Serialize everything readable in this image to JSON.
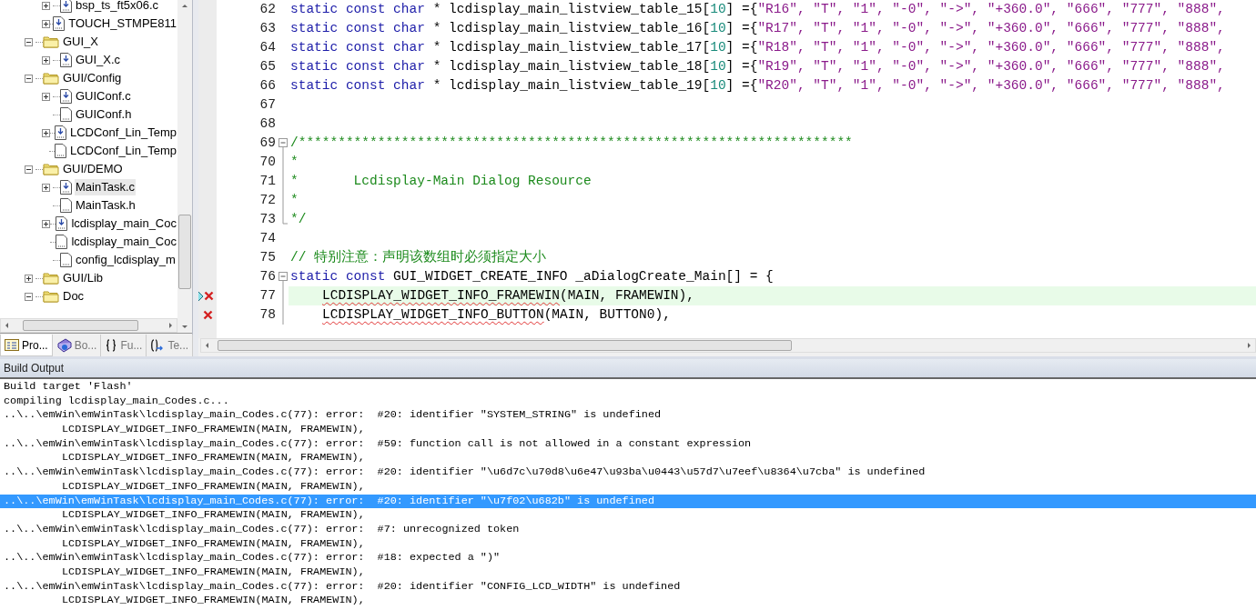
{
  "project_panel": {
    "tree": {
      "continued_items": [
        {
          "label": "bsp_ts_ft5x06.c",
          "kind": "source",
          "expanded": false,
          "selected": false
        },
        {
          "label": "TOUCH_STMPE811",
          "kind": "source",
          "expanded": false,
          "selected": false
        }
      ],
      "items": [
        {
          "label": "GUI_X",
          "kind": "folder",
          "expanded": true,
          "selected": false,
          "children": [
            {
              "label": "GUI_X.c",
              "kind": "source",
              "expanded": false,
              "selected": false
            }
          ]
        },
        {
          "label": "GUI/Config",
          "kind": "folder",
          "expanded": true,
          "selected": false,
          "children": [
            {
              "label": "GUIConf.c",
              "kind": "source",
              "expanded": false,
              "selected": false
            },
            {
              "label": "GUIConf.h",
              "kind": "header",
              "selected": false
            },
            {
              "label": "LCDConf_Lin_Temp",
              "kind": "source",
              "expanded": false,
              "selected": false
            },
            {
              "label": "LCDConf_Lin_Temp",
              "kind": "header",
              "selected": false
            }
          ]
        },
        {
          "label": "GUI/DEMO",
          "kind": "folder",
          "expanded": true,
          "selected": false,
          "children": [
            {
              "label": "MainTask.c",
              "kind": "source",
              "expanded": false,
              "selected": true
            },
            {
              "label": "MainTask.h",
              "kind": "header",
              "selected": false
            },
            {
              "label": "lcdisplay_main_Coc",
              "kind": "source",
              "expanded": false,
              "selected": false
            },
            {
              "label": "lcdisplay_main_Coc",
              "kind": "header",
              "selected": false
            },
            {
              "label": "config_lcdisplay_m",
              "kind": "header",
              "selected": false
            }
          ]
        },
        {
          "label": "GUI/Lib",
          "kind": "folder",
          "expanded": false,
          "selected": false
        },
        {
          "label": "Doc",
          "kind": "folder",
          "expanded": true,
          "selected": false
        }
      ]
    },
    "tabs": [
      {
        "label": "Pro...",
        "kind": "project",
        "selected": true
      },
      {
        "label": "Bo...",
        "kind": "books",
        "selected": false
      },
      {
        "label": "Fu...",
        "kind": "functions",
        "selected": false
      },
      {
        "label": "Te...",
        "kind": "templates",
        "selected": false
      }
    ]
  },
  "editor": {
    "lines": [
      {
        "number": "62",
        "error": false,
        "arrow": false,
        "fold_start": false,
        "in_fold": false,
        "fold_end": false,
        "current": false,
        "indented": false,
        "tokens": [
          {
            "kind": "keyword",
            "text": "static const char"
          },
          {
            "kind": "plain",
            "text": " * lcdisplay_main_listview_table_15["
          },
          {
            "kind": "number",
            "text": "10"
          },
          {
            "kind": "plain",
            "text": "] ={"
          },
          {
            "kind": "string",
            "text": "\"R16\", \"T\", \"1\", \"-0\", \"->\", \"+360.0\", \"666\", \"777\", \"888\","
          }
        ]
      },
      {
        "number": "63",
        "error": false,
        "arrow": false,
        "fold_start": false,
        "in_fold": false,
        "fold_end": false,
        "current": false,
        "indented": false,
        "tokens": [
          {
            "kind": "keyword",
            "text": "static const char"
          },
          {
            "kind": "plain",
            "text": " * lcdisplay_main_listview_table_16["
          },
          {
            "kind": "number",
            "text": "10"
          },
          {
            "kind": "plain",
            "text": "] ={"
          },
          {
            "kind": "string",
            "text": "\"R17\", \"T\", \"1\", \"-0\", \"->\", \"+360.0\", \"666\", \"777\", \"888\","
          }
        ]
      },
      {
        "number": "64",
        "error": false,
        "arrow": false,
        "fold_start": false,
        "in_fold": false,
        "fold_end": false,
        "current": false,
        "indented": false,
        "tokens": [
          {
            "kind": "keyword",
            "text": "static const char"
          },
          {
            "kind": "plain",
            "text": " * lcdisplay_main_listview_table_17["
          },
          {
            "kind": "number",
            "text": "10"
          },
          {
            "kind": "plain",
            "text": "] ={"
          },
          {
            "kind": "string",
            "text": "\"R18\", \"T\", \"1\", \"-0\", \"->\", \"+360.0\", \"666\", \"777\", \"888\","
          }
        ]
      },
      {
        "number": "65",
        "error": false,
        "arrow": false,
        "fold_start": false,
        "in_fold": false,
        "fold_end": false,
        "current": false,
        "indented": false,
        "tokens": [
          {
            "kind": "keyword",
            "text": "static const char"
          },
          {
            "kind": "plain",
            "text": " * lcdisplay_main_listview_table_18["
          },
          {
            "kind": "number",
            "text": "10"
          },
          {
            "kind": "plain",
            "text": "] ={"
          },
          {
            "kind": "string",
            "text": "\"R19\", \"T\", \"1\", \"-0\", \"->\", \"+360.0\", \"666\", \"777\", \"888\","
          }
        ]
      },
      {
        "number": "66",
        "error": false,
        "arrow": false,
        "fold_start": false,
        "in_fold": false,
        "fold_end": false,
        "current": false,
        "indented": false,
        "tokens": [
          {
            "kind": "keyword",
            "text": "static const char"
          },
          {
            "kind": "plain",
            "text": " * lcdisplay_main_listview_table_19["
          },
          {
            "kind": "number",
            "text": "10"
          },
          {
            "kind": "plain",
            "text": "] ={"
          },
          {
            "kind": "string",
            "text": "\"R20\", \"T\", \"1\", \"-0\", \"->\", \"+360.0\", \"666\", \"777\", \"888\","
          }
        ]
      },
      {
        "number": "67",
        "error": false,
        "arrow": false,
        "fold_start": false,
        "in_fold": false,
        "fold_end": false,
        "current": false
      },
      {
        "number": "68",
        "error": false,
        "arrow": false,
        "fold_start": false,
        "in_fold": false,
        "fold_end": false,
        "current": false
      },
      {
        "number": "69",
        "error": false,
        "arrow": false,
        "fold_start": true,
        "in_fold": false,
        "fold_end": false,
        "current": false,
        "indented": false,
        "tokens": [
          {
            "kind": "comment",
            "text": "/**********************************************************************"
          }
        ]
      },
      {
        "number": "70",
        "error": false,
        "arrow": false,
        "fold_start": false,
        "in_fold": true,
        "fold_end": false,
        "current": false,
        "indented": false,
        "tokens": [
          {
            "kind": "comment",
            "text": "*"
          }
        ]
      },
      {
        "number": "71",
        "error": false,
        "arrow": false,
        "fold_start": false,
        "in_fold": true,
        "fold_end": false,
        "current": false,
        "indented": false,
        "tokens": [
          {
            "kind": "comment",
            "text": "*       Lcdisplay-Main Dialog Resource"
          }
        ]
      },
      {
        "number": "72",
        "error": false,
        "arrow": false,
        "fold_start": false,
        "in_fold": true,
        "fold_end": false,
        "current": false,
        "indented": false,
        "tokens": [
          {
            "kind": "comment",
            "text": "*"
          }
        ]
      },
      {
        "number": "73",
        "error": false,
        "arrow": false,
        "fold_start": false,
        "in_fold": false,
        "fold_end": true,
        "current": false,
        "indented": false,
        "tokens": [
          {
            "kind": "comment",
            "text": "*/"
          }
        ]
      },
      {
        "number": "74",
        "error": false,
        "arrow": false,
        "fold_start": false,
        "in_fold": false,
        "fold_end": false,
        "current": false
      },
      {
        "number": "75",
        "error": false,
        "arrow": false,
        "fold_start": false,
        "in_fold": false,
        "fold_end": false,
        "current": false,
        "indented": false,
        "tokens": [
          {
            "kind": "comment",
            "text": "// 特别注意：声明该数组时必须指定大小"
          }
        ]
      },
      {
        "number": "76",
        "error": false,
        "arrow": false,
        "fold_start": true,
        "in_fold": false,
        "fold_end": false,
        "current": false,
        "indented": false,
        "tokens": [
          {
            "kind": "keyword",
            "text": "static const"
          },
          {
            "kind": "plain",
            "text": " GUI_WIDGET_CREATE_INFO _aDialogCreate_Main[] = {"
          }
        ]
      },
      {
        "number": "77",
        "error": true,
        "arrow": true,
        "fold_start": false,
        "in_fold": true,
        "fold_end": false,
        "current": true,
        "indented": true,
        "tokens": [
          {
            "kind": "error",
            "text": "LCDISPLAY_WIDGET_INFO_FRAMEWIN"
          },
          {
            "kind": "plain",
            "text": "(MAIN, FRAMEWIN),"
          }
        ]
      },
      {
        "number": "78",
        "error": true,
        "arrow": false,
        "fold_start": false,
        "in_fold": true,
        "fold_end": false,
        "current": false,
        "indented": true,
        "tokens": [
          {
            "kind": "error",
            "text": "LCDISPLAY_WIDGET_INFO_BUTTON"
          },
          {
            "kind": "plain",
            "text": "(MAIN, BUTTON0),"
          }
        ]
      }
    ]
  },
  "build_output": {
    "title": "Build Output",
    "lines": [
      {
        "kind": "message",
        "selected": false,
        "text": "Build target 'Flash'"
      },
      {
        "kind": "message",
        "selected": false,
        "text": "compiling lcdisplay_main_Codes.c..."
      },
      {
        "kind": "message",
        "selected": false,
        "text": "..\\..\\emWin\\emWinTask\\lcdisplay_main_Codes.c(77): error:  #20: identifier \"SYSTEM_STRING\" is undefined"
      },
      {
        "kind": "context",
        "selected": false,
        "text": "LCDISPLAY_WIDGET_INFO_FRAMEWIN(MAIN, FRAMEWIN),"
      },
      {
        "kind": "message",
        "selected": false,
        "text": "..\\..\\emWin\\emWinTask\\lcdisplay_main_Codes.c(77): error:  #59: function call is not allowed in a constant expression"
      },
      {
        "kind": "context",
        "selected": false,
        "text": "LCDISPLAY_WIDGET_INFO_FRAMEWIN(MAIN, FRAMEWIN),"
      },
      {
        "kind": "message",
        "selected": false,
        "text": "..\\..\\emWin\\emWinTask\\lcdisplay_main_Codes.c(77): error:  #20: identifier \"\\u6d7c\\u70d8\\u6e47\\u93ba\\u0443\\u57d7\\u7eef\\u8364\\u7cba\" is undefined"
      },
      {
        "kind": "context",
        "selected": false,
        "text": "LCDISPLAY_WIDGET_INFO_FRAMEWIN(MAIN, FRAMEWIN),"
      },
      {
        "kind": "message",
        "selected": true,
        "text": "..\\..\\emWin\\emWinTask\\lcdisplay_main_Codes.c(77): error:  #20: identifier \"\\u7f02\\u682b\" is undefined"
      },
      {
        "kind": "context",
        "selected": false,
        "text": "LCDISPLAY_WIDGET_INFO_FRAMEWIN(MAIN, FRAMEWIN),"
      },
      {
        "kind": "message",
        "selected": false,
        "text": "..\\..\\emWin\\emWinTask\\lcdisplay_main_Codes.c(77): error:  #7: unrecognized token"
      },
      {
        "kind": "context",
        "selected": false,
        "text": "LCDISPLAY_WIDGET_INFO_FRAMEWIN(MAIN, FRAMEWIN),"
      },
      {
        "kind": "message",
        "selected": false,
        "text": "..\\..\\emWin\\emWinTask\\lcdisplay_main_Codes.c(77): error:  #18: expected a \")\""
      },
      {
        "kind": "context",
        "selected": false,
        "text": "LCDISPLAY_WIDGET_INFO_FRAMEWIN(MAIN, FRAMEWIN),"
      },
      {
        "kind": "message",
        "selected": false,
        "text": "..\\..\\emWin\\emWinTask\\lcdisplay_main_Codes.c(77): error:  #20: identifier \"CONFIG_LCD_WIDTH\" is undefined"
      },
      {
        "kind": "context",
        "selected": false,
        "text": "LCDISPLAY_WIDGET_INFO_FRAMEWIN(MAIN, FRAMEWIN),"
      }
    ]
  }
}
